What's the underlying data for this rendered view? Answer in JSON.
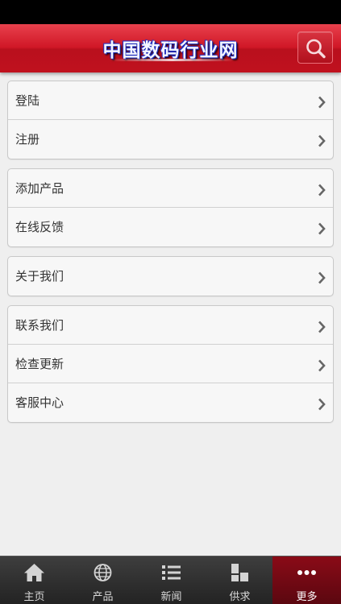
{
  "header": {
    "title": "中国数码行业网",
    "search_icon": "search-icon"
  },
  "menu": {
    "groups": [
      {
        "items": [
          {
            "label": "登陆"
          },
          {
            "label": "注册"
          }
        ]
      },
      {
        "items": [
          {
            "label": "添加产品"
          },
          {
            "label": "在线反馈"
          }
        ]
      },
      {
        "items": [
          {
            "label": "关于我们"
          }
        ]
      },
      {
        "items": [
          {
            "label": "联系我们"
          },
          {
            "label": "检查更新"
          },
          {
            "label": "客服中心"
          }
        ]
      }
    ]
  },
  "tabbar": {
    "tabs": [
      {
        "label": "主页",
        "icon": "home-icon"
      },
      {
        "label": "产品",
        "icon": "globe-icon"
      },
      {
        "label": "新闻",
        "icon": "list-icon"
      },
      {
        "label": "供求",
        "icon": "grid-icon"
      },
      {
        "label": "更多",
        "icon": "more-icon",
        "active": true
      }
    ]
  },
  "colors": {
    "header_red": "#d01726",
    "active_tab": "#8a0b17",
    "background": "#efefef"
  }
}
